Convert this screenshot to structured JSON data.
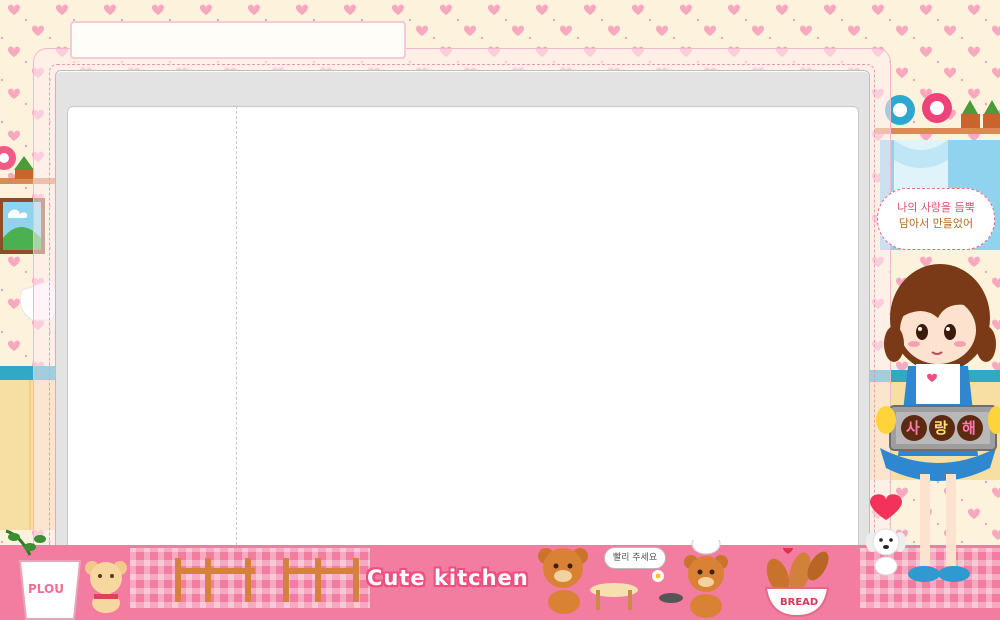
{
  "window": {
    "title": ""
  },
  "speech_bubble": {
    "line1": "나의 사랑을 듬뿍",
    "line2": "담아서 만들었어"
  },
  "bears_bubble": "빨리 주세요",
  "logo": "Cute kitchen",
  "pot_label": "PLOU",
  "bread_label": "BREAD",
  "cookies": [
    "사",
    "랑",
    "해"
  ],
  "colors": {
    "background": "#fdf3dc",
    "hearts": "#f8a9c0",
    "frame": "#f3b9cb",
    "floor": "#f27da0",
    "accent": "#ee4f7f"
  },
  "icons": [
    "heart-pattern",
    "donut-icon",
    "plant-icon",
    "bear-icon",
    "girl-chef-illustration",
    "puppy-icon",
    "bread-basket-icon"
  ]
}
